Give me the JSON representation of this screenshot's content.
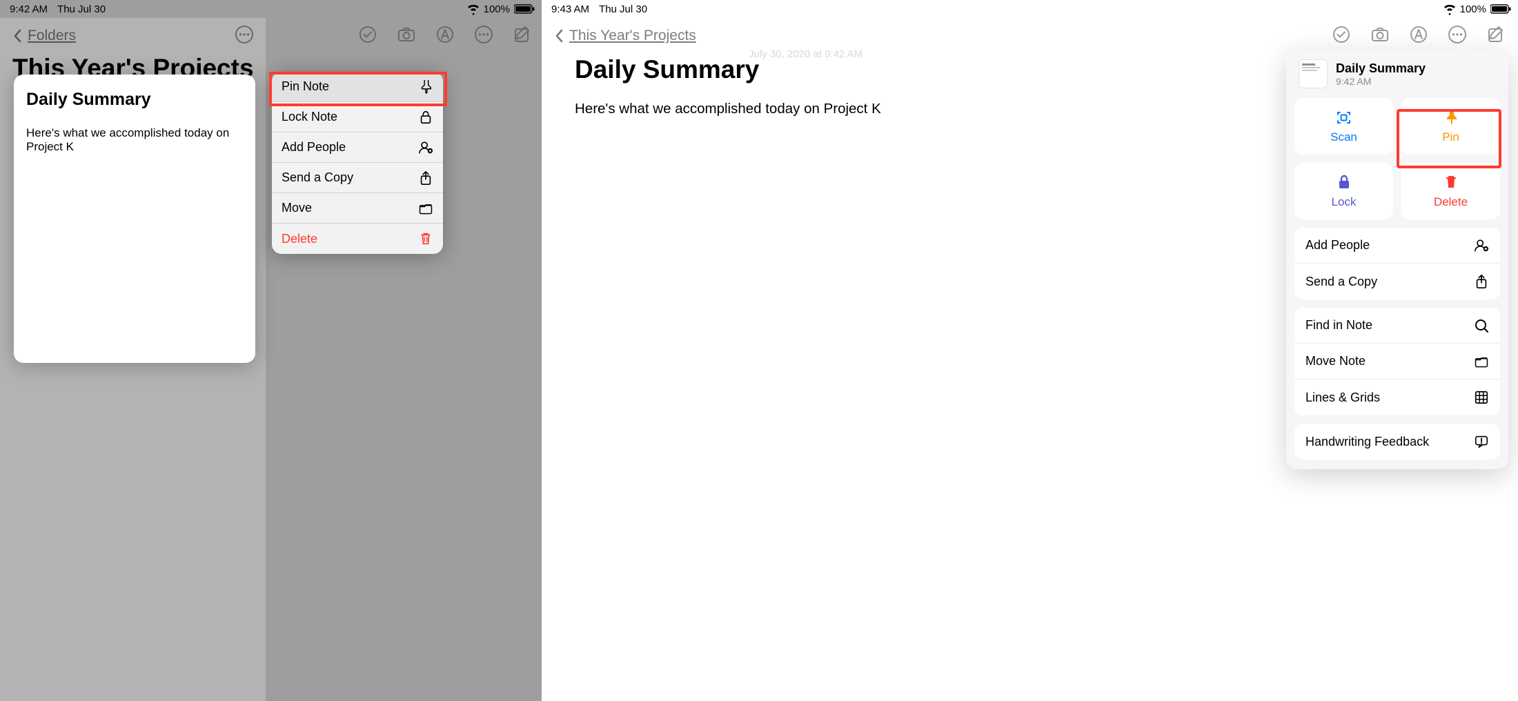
{
  "left": {
    "status": {
      "time": "9:42 AM",
      "date": "Thu Jul 30",
      "battery": "100%"
    },
    "back_label": "Folders",
    "folder_title": "This Year's Projects",
    "note_card": {
      "title": "Daily Summary",
      "body": "Here's what we accomplished today on Project K"
    },
    "menu": {
      "pin": "Pin Note",
      "lock": "Lock Note",
      "add_people": "Add People",
      "send_copy": "Send a Copy",
      "move": "Move",
      "delete": "Delete"
    }
  },
  "right": {
    "status": {
      "time": "9:43 AM",
      "date": "Thu Jul 30",
      "battery": "100%"
    },
    "back_label": "This Year's Projects",
    "note_title": "Daily Summary",
    "note_date_ghost": "July 30, 2020 at 9:42 AM",
    "note_body": "Here's what we accomplished today on Project K",
    "popover": {
      "header_title": "Daily Summary",
      "header_sub": "9:42 AM",
      "tiles": {
        "scan": "Scan",
        "pin": "Pin",
        "lock": "Lock",
        "delete": "Delete"
      },
      "rows": {
        "add_people": "Add People",
        "send_copy": "Send a Copy",
        "find": "Find in Note",
        "move": "Move Note",
        "lines": "Lines & Grids",
        "handwriting": "Handwriting Feedback"
      }
    }
  }
}
